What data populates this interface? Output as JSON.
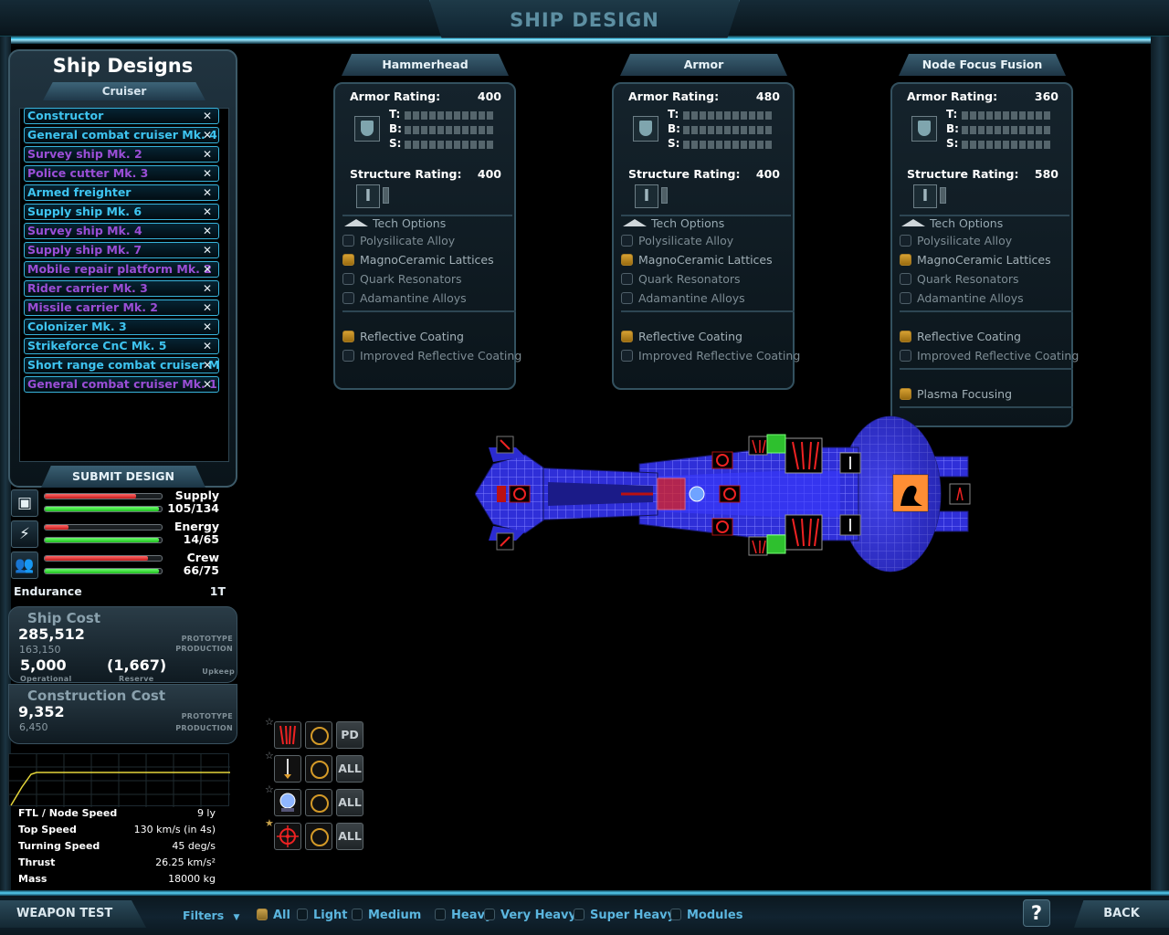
{
  "page_title": "SHIP DESIGN",
  "designs_panel": {
    "title": "Ship Designs",
    "category": "Cruiser",
    "items": [
      {
        "label": "Constructor",
        "color": "#3ec4f0"
      },
      {
        "label": "General combat cruiser Mk. 4",
        "color": "#3ec4f0"
      },
      {
        "label": "Survey ship Mk. 2",
        "color": "#9a4ed6"
      },
      {
        "label": "Police cutter Mk. 3",
        "color": "#9a4ed6"
      },
      {
        "label": "Armed freighter",
        "color": "#3ec4f0"
      },
      {
        "label": "Supply ship Mk. 6",
        "color": "#3ec4f0"
      },
      {
        "label": "Survey ship Mk. 4",
        "color": "#9a4ed6"
      },
      {
        "label": "Supply ship Mk. 7",
        "color": "#9a4ed6"
      },
      {
        "label": "Mobile repair platform Mk. 2",
        "color": "#9a4ed6"
      },
      {
        "label": "Rider carrier Mk. 3",
        "color": "#9a4ed6"
      },
      {
        "label": "Missile carrier Mk. 2",
        "color": "#9a4ed6"
      },
      {
        "label": "Colonizer Mk. 3",
        "color": "#3ec4f0"
      },
      {
        "label": "Strikeforce CnC Mk. 5",
        "color": "#3ec4f0"
      },
      {
        "label": "Short range combat cruiser Mk.",
        "color": "#3ec4f0"
      },
      {
        "label": "General combat cruiser Mk. 12",
        "color": "#9a4ed6"
      }
    ],
    "submit_label": "SUBMIT DESIGN"
  },
  "resources": [
    {
      "name": "Supply",
      "value": "105/134",
      "icon": "box-icon",
      "required": 0.78,
      "available": 0.98
    },
    {
      "name": "Energy",
      "value": "14/65",
      "icon": "energy-cell-icon",
      "required": 0.2,
      "available": 0.98
    },
    {
      "name": "Crew",
      "value": "66/75",
      "icon": "crew-icon",
      "required": 0.88,
      "available": 0.98
    }
  ],
  "endurance": {
    "label": "Endurance",
    "value": "1T"
  },
  "ship_cost": {
    "title": "Ship Cost",
    "prototype": "285,512",
    "production": "163,150",
    "prototype_label": "PROTOTYPE",
    "production_label": "PRODUCTION",
    "operational": "5,000",
    "operational_label": "Operational",
    "reserve": "(1,667)",
    "reserve_label": "Reserve",
    "upkeep_label": "Upkeep"
  },
  "construction_cost": {
    "title": "Construction Cost",
    "prototype": "9,352",
    "production": "6,450",
    "prototype_label": "PROTOTYPE",
    "production_label": "PRODUCTION"
  },
  "stats": [
    {
      "label": "FTL / Node Speed",
      "value": "9 ly"
    },
    {
      "label": "Top Speed",
      "value": "130 km/s (in 4s)"
    },
    {
      "label": "Turning Speed",
      "value": "45 deg/s"
    },
    {
      "label": "Thrust",
      "value": "26.25 km/s²"
    },
    {
      "label": "Mass",
      "value": "18000 kg"
    }
  ],
  "tech_panels": [
    {
      "name": "Hammerhead",
      "armor_label": "Armor Rating:",
      "armor": "400",
      "structure_label": "Structure Rating:",
      "structure": "400",
      "t": "T:",
      "b": "B:",
      "s": "S:",
      "tech_label": "Tech Options",
      "options": [
        {
          "label": "Polysilicate Alloy",
          "checked": false
        },
        {
          "label": "MagnoCeramic Lattices",
          "checked": true
        },
        {
          "label": "Quark Resonators",
          "checked": false
        },
        {
          "label": "Adamantine Alloys",
          "checked": false
        }
      ],
      "coatings": [
        {
          "label": "Reflective Coating",
          "checked": true
        },
        {
          "label": "Improved Reflective Coating",
          "checked": false
        }
      ],
      "extra": []
    },
    {
      "name": "Armor",
      "armor_label": "Armor Rating:",
      "armor": "480",
      "structure_label": "Structure Rating:",
      "structure": "400",
      "t": "T:",
      "b": "B:",
      "s": "S:",
      "tech_label": "Tech Options",
      "options": [
        {
          "label": "Polysilicate Alloy",
          "checked": false
        },
        {
          "label": "MagnoCeramic Lattices",
          "checked": true
        },
        {
          "label": "Quark Resonators",
          "checked": false
        },
        {
          "label": "Adamantine Alloys",
          "checked": false
        }
      ],
      "coatings": [
        {
          "label": "Reflective Coating",
          "checked": true
        },
        {
          "label": "Improved Reflective Coating",
          "checked": false
        }
      ],
      "extra": []
    },
    {
      "name": "Node Focus Fusion",
      "armor_label": "Armor Rating:",
      "armor": "360",
      "structure_label": "Structure Rating:",
      "structure": "580",
      "t": "T:",
      "b": "B:",
      "s": "S:",
      "tech_label": "Tech Options",
      "options": [
        {
          "label": "Polysilicate Alloy",
          "checked": false
        },
        {
          "label": "MagnoCeramic Lattices",
          "checked": true
        },
        {
          "label": "Quark Resonators",
          "checked": false
        },
        {
          "label": "Adamantine Alloys",
          "checked": false
        }
      ],
      "coatings": [
        {
          "label": "Reflective Coating",
          "checked": true
        },
        {
          "label": "Improved Reflective Coating",
          "checked": false
        }
      ],
      "extra": [
        {
          "label": "Plasma Focusing",
          "checked": true
        }
      ]
    }
  ],
  "weapon_groups": [
    {
      "icon": "missile-pod-icon",
      "mode": "PD",
      "star": "grey"
    },
    {
      "icon": "torpedo-icon",
      "mode": "ALL",
      "star": "grey"
    },
    {
      "icon": "sphere-weapon-icon",
      "mode": "ALL",
      "star": "grey"
    },
    {
      "icon": "crosshair-icon",
      "mode": "ALL",
      "star": "gold"
    }
  ],
  "bottom_bar": {
    "weapon_test": "WEAPON TEST",
    "filters_label": "Filters",
    "filters": [
      {
        "label": "All",
        "checked": true
      },
      {
        "label": "Light",
        "checked": false
      },
      {
        "label": "Medium",
        "checked": false
      },
      {
        "label": "Heavy",
        "checked": false
      },
      {
        "label": "Very Heavy",
        "checked": false
      },
      {
        "label": "Super Heavy",
        "checked": false
      },
      {
        "label": "Modules",
        "checked": false
      }
    ],
    "help": "?",
    "back": "BACK"
  }
}
